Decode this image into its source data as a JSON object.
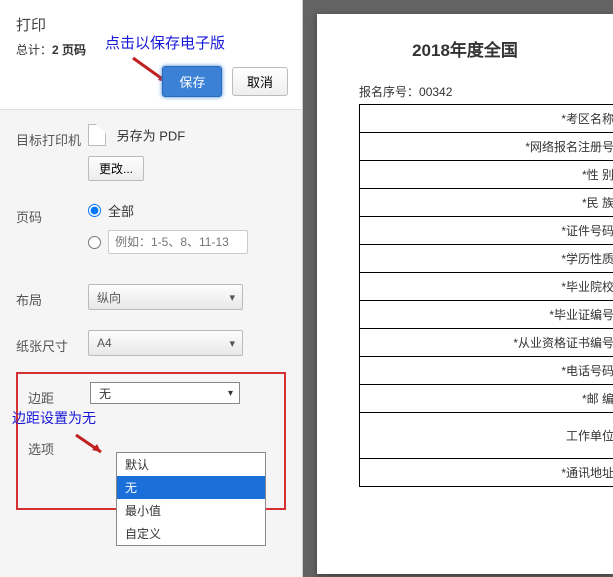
{
  "header": {
    "title": "打印",
    "total_prefix": "总计：",
    "total_value": "2 页码",
    "save_btn": "保存",
    "cancel_btn": "取消",
    "annotation_save": "点击以保存电子版"
  },
  "dest": {
    "label": "目标打印机",
    "save_as": "另存为 PDF",
    "change": "更改..."
  },
  "pages": {
    "label": "页码",
    "all": "全部",
    "range_placeholder": "例如：1-5、8、11-13"
  },
  "layout": {
    "label": "布局",
    "value": "纵向"
  },
  "paper": {
    "label": "纸张尺寸",
    "value": "A4"
  },
  "margins": {
    "annotation": "边距设置为无",
    "label": "边距",
    "current": "无",
    "options": [
      "默认",
      "无",
      "最小值",
      "自定义"
    ]
  },
  "options": {
    "label": "选项"
  },
  "preview": {
    "doc_title": "2018年度全国",
    "reg_no_label": "报名序号：",
    "reg_no_value": "00342",
    "rows": [
      "*考区名称",
      "*网络报名注册号",
      "*性 别",
      "*民 族",
      "*证件号码",
      "*学历性质",
      "*毕业院校",
      "*毕业证编号",
      "*从业资格证书编号",
      "*电话号码",
      "*邮 编",
      "工作单位",
      "*通讯地址"
    ]
  }
}
